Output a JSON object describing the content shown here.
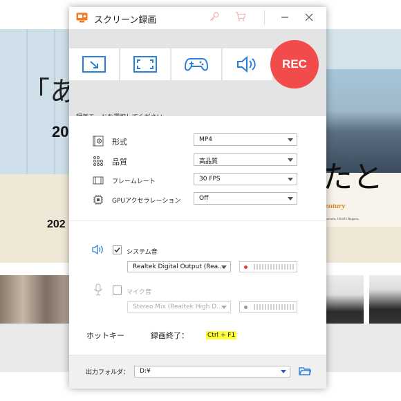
{
  "background": {
    "quote_text": "「あ",
    "year_1": "20",
    "year_2": "202",
    "kana": "たと",
    "century": "entury",
    "credit": "namoto, Hiroshi Nagano,"
  },
  "window": {
    "title": "スクリーン録画",
    "icons": {
      "app": "screen-recorder-icon",
      "key": "key-icon",
      "cart": "cart-icon",
      "minimize": "minimize-icon",
      "close": "close-icon"
    }
  },
  "modes": {
    "buttons": [
      {
        "name": "region-capture",
        "icon": "region-select-icon"
      },
      {
        "name": "fullscreen-capture",
        "icon": "fullscreen-icon"
      },
      {
        "name": "game-capture",
        "icon": "gamepad-icon"
      },
      {
        "name": "audio-only",
        "icon": "speaker-icon"
      }
    ],
    "rec_label": "REC",
    "hint": "録画モードを選択してください。"
  },
  "settings": {
    "format": {
      "label": "形式",
      "value": "MP4",
      "icon": "format-gear-icon"
    },
    "quality": {
      "label": "品質",
      "value": "高品質",
      "icon": "quality-dots-icon"
    },
    "framerate": {
      "label": "フレームレート",
      "value": "30 FPS",
      "icon": "film-icon"
    },
    "gpu": {
      "label": "GPUアクセラレーション",
      "value": "Off",
      "icon": "gpu-chip-icon"
    }
  },
  "audio": {
    "system": {
      "checked": true,
      "label": "システム音",
      "device": "Realtek Digital Output (Rea...",
      "icon": "speaker-icon"
    },
    "mic": {
      "checked": false,
      "label": "マイク音",
      "device": "Stereo Mix (Realtek High D...",
      "icon": "microphone-icon"
    }
  },
  "hotkey": {
    "label": "ホットキー",
    "stop_label": "録画終了：",
    "stop_key": "Ctrl + F1"
  },
  "output": {
    "label": "出力フォルダ：",
    "path": "D:¥",
    "icon": "folder-icon"
  },
  "colors": {
    "rec": "#f24b4c",
    "accent": "#2a7fd8",
    "hotkey_highlight": "#ffff3a"
  }
}
